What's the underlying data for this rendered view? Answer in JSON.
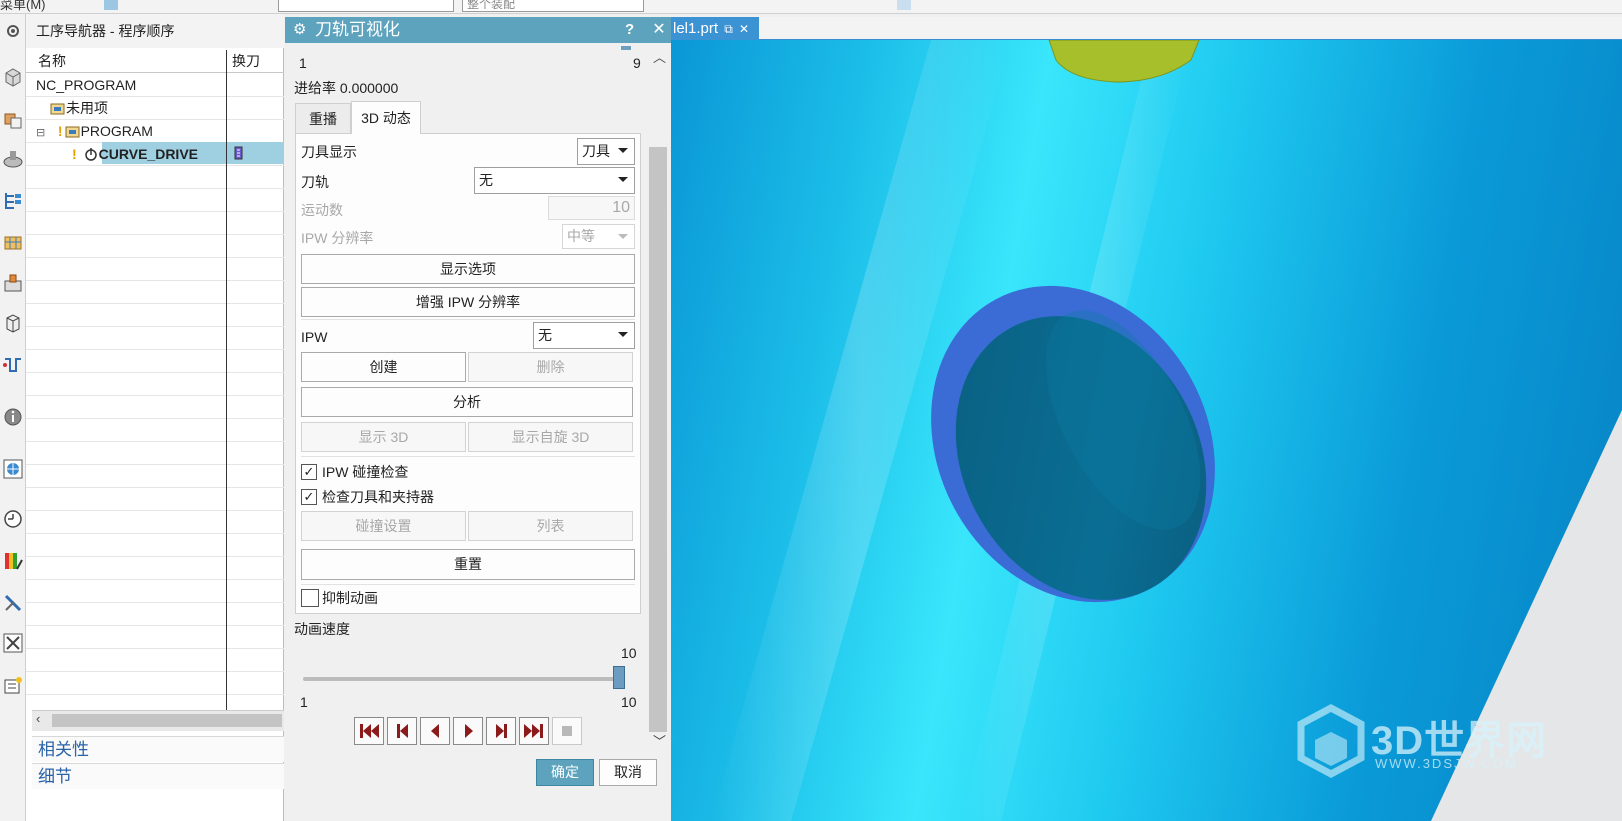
{
  "topbar": {
    "menu_label": "菜单(M)",
    "combo_left": "",
    "combo_right": "整个装配"
  },
  "navigator": {
    "title": "工序导航器 - 程序顺序",
    "col_name": "名称",
    "col_toolchange": "换刀",
    "rows": [
      {
        "label": "NC_PROGRAM"
      },
      {
        "label": "未用项"
      },
      {
        "label": "PROGRAM"
      },
      {
        "label": "CURVE_DRIVE"
      }
    ],
    "sections": [
      "相关性",
      "细节"
    ]
  },
  "dialog": {
    "title": "刀轨可视化",
    "help": "?",
    "close": "✕",
    "slider_top": {
      "min": "1",
      "max": "9"
    },
    "feed_rate": "进给率 0.000000",
    "tabs": [
      "重播",
      "3D 动态"
    ],
    "tool_display": {
      "label": "刀具显示",
      "value": "刀具"
    },
    "tool_path": {
      "label": "刀轨",
      "value": "无"
    },
    "motions": {
      "label": "运动数",
      "value": "10"
    },
    "ipw_resolution": {
      "label": "IPW 分辨率",
      "value": "中等"
    },
    "display_options": "显示选项",
    "enhance_ipw": "增强 IPW 分辨率",
    "ipw": {
      "label": "IPW",
      "value": "无"
    },
    "create": "创建",
    "delete": "删除",
    "analyze": "分析",
    "show_3d": "显示 3D",
    "show_spin_3d": "显示自旋 3D",
    "ipw_collision": {
      "label": "IPW 碰撞检查",
      "checked": true
    },
    "check_tool_holder": {
      "label": "检查刀具和夹持器",
      "checked": true
    },
    "collision_settings": "碰撞设置",
    "list": "列表",
    "reset": "重置",
    "suppress_animation": {
      "label": "抑制动画",
      "checked": false
    },
    "animation_speed": {
      "label": "动画速度",
      "value": "10",
      "min": "1",
      "max": "10",
      "level": 1.0
    },
    "ok": "确定",
    "cancel": "取消"
  },
  "viewport": {
    "tab_label": "lel1.prt",
    "watermark": "3D世界网",
    "watermark_url": "WWW.3DSJW.COM"
  }
}
